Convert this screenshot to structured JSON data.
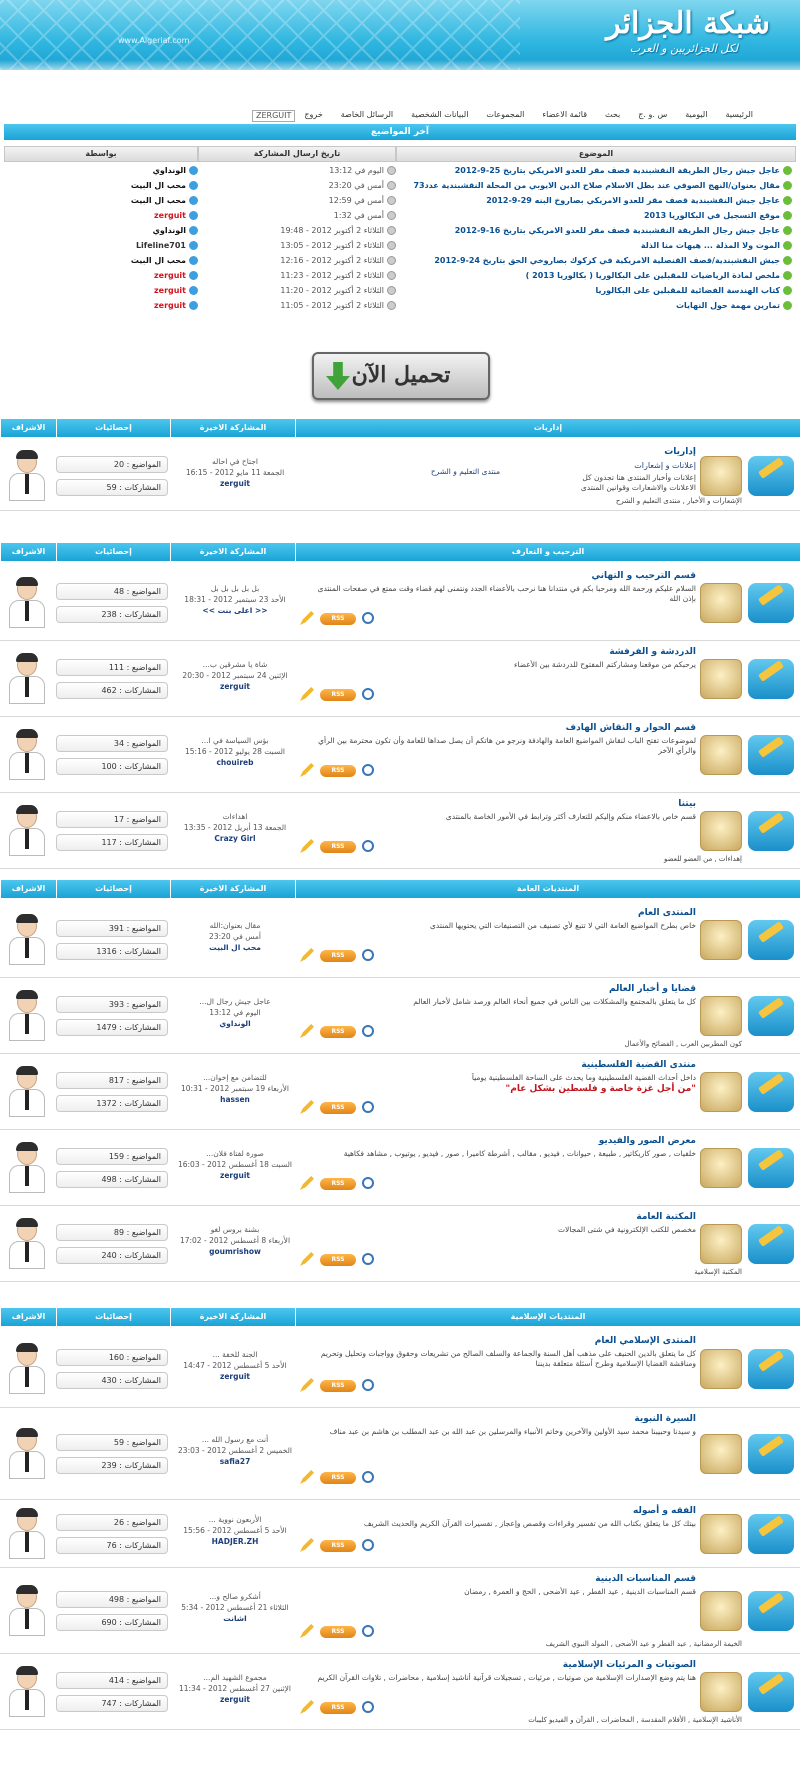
{
  "site": {
    "logo_title": "شبكة الجزائر",
    "logo_subtitle": "لكل الجزائريين و العرب",
    "logo_url": "www.Algeriaf.com"
  },
  "nav": {
    "items": [
      "الرئيسية",
      "اليومية",
      "س .و .ج",
      "بحث",
      "قائمة الاعضاء",
      "المجموعات",
      "البيانات الشخصية",
      "الرسائل الخاصة",
      "خروج"
    ],
    "user": "ZERGUIT"
  },
  "latest": {
    "title": "آخر المواضيع",
    "headers": {
      "topic": "الموضوع",
      "date": "تاريخ ارسال المشاركة",
      "by": "بواسطة"
    },
    "rows": [
      {
        "topic": "عاجل جيش رجال الطريقة النقشبندية قصف مقر للعدو الامريكي بتاريخ 25-9-2012",
        "date": "اليوم في 13:12",
        "user": "الونداوي",
        "color": "#111"
      },
      {
        "topic": "مقال بعنوان/النهج الصوفي عند بطل الاسلام صلاح الدين الايوبي من المحلة النقشبندية عدد73",
        "date": "أمس في 23:20",
        "user": "محب ال البيت",
        "color": "#111"
      },
      {
        "topic": "عاجل جيش النقشبندية قصف مقر للعدو الامريكي بصاروخ البنه 29-9-2012",
        "date": "أمس في 12:59",
        "user": "محب ال البيت",
        "color": "#111"
      },
      {
        "topic": "موقع التسجيل في البكالوريا 2013",
        "date": "أمس في 1:32",
        "user": "zerguit",
        "color": "#d0161f"
      },
      {
        "topic": "عاجل جيش رجال الطريقة النقشبندية قصف مقر للعدو الامريكي بتاريخ 16-9-2012",
        "date": "الثلاثاء 2 أكتوبر 2012 - 19:48",
        "user": "الونداوي",
        "color": "#111"
      },
      {
        "topic": "الموت ولا المذلة ... هيهات منا الذلة",
        "date": "الثلاثاء 2 أكتوبر 2012 - 13:05",
        "user": "Lifeline701",
        "color": "#333"
      },
      {
        "topic": "جيش النقشبندية/قصف القنصلية الامريكية في كركوك بصاروخي الحق بتاريخ 24-9-2012",
        "date": "الثلاثاء 2 أكتوبر 2012 - 12:16",
        "user": "محب ال البيت",
        "color": "#111"
      },
      {
        "topic": "ملخص لمادة الرياضيات للمقبلين على البكالوريا ( بكالوريا 2013 )",
        "date": "الثلاثاء 2 أكتوبر 2012 - 11:23",
        "user": "zerguit",
        "color": "#d0161f"
      },
      {
        "topic": "كتاب الهندسة الفضائية للمقبلين على البكالوريا",
        "date": "الثلاثاء 2 أكتوبر 2012 - 11:20",
        "user": "zerguit",
        "color": "#d0161f"
      },
      {
        "topic": "تمارين مهمة حول النهايات",
        "date": "الثلاثاء 2 أكتوبر 2012 - 11:05",
        "user": "zerguit",
        "color": "#d0161f"
      }
    ]
  },
  "download_label": "تحميل الآن",
  "col_headers": {
    "last": "المشاركة الاخيرة",
    "stats": "إحصائيات",
    "mod": "الاشراف"
  },
  "stat_labels": {
    "topics": "المواضيع :",
    "posts": "المشاركات :"
  },
  "sections": [
    {
      "title": "إداريات",
      "forums": [
        {
          "name": "إداريات",
          "desc": "إعلانات و إشعارات",
          "desc2": "إعلانات وأخبار المنتدى هنا تجدون كل الاعلانات والاشعارات وقوانين المنتدى",
          "sub": "الإشعارات و الأخبار , منتدى التعليم و الشرح",
          "last_title": "اجتاح في احاله",
          "last_date": "الجمعة 11 مايو 2012 - 16:15",
          "last_user": "zerguit",
          "topics": "20",
          "posts": "59",
          "extra": "منتدى التعليم و الشرح"
        }
      ]
    },
    {
      "title": "الترحيب و التعارف",
      "forums": [
        {
          "name": "قسم الترحيب و التهاني",
          "desc": "السلام عليكم ورحمة الله ومرحبا بكم في منتدانا هنا نرحب بالأعضاء الجدد ونتمنى لهم قضاء وقت ممتع في صفحات المنتدى بإذن الله",
          "sub": "",
          "last_title": "بل بل بل بل بل",
          "last_date": "الأحد 23 سبتمبر 2012 - 18:31",
          "last_user": "<< اعلى بنت >>",
          "topics": "48",
          "posts": "238"
        },
        {
          "name": "الدردشة و الفرفشة",
          "desc": "يرحبكم من موقعنا ومشاركتم المفتوح للدردشة بين الأعضاء",
          "sub": "",
          "last_title": "شاة يا مشرقين ب...",
          "last_date": "الإثنين 24 سبتمبر 2012 - 20:30",
          "last_user": "zerguit",
          "topics": "111",
          "posts": "462"
        },
        {
          "name": "قسم الحوار و النقاش الهادف",
          "desc": "لموضوعات تفتح الباب لنقاش المواضيع العامة والهادفة ونرجو من هاتكم أن يصل صداها للعامة وأن تكون محترمة بين الرأي والرأي الآخر",
          "sub": "",
          "last_title": "بؤس السياسة في ا...",
          "last_date": "السبت 28 يوليو 2012 - 15:16",
          "last_user": "chouireb",
          "topics": "34",
          "posts": "100"
        },
        {
          "name": "بيتنا",
          "desc": "قسم خاص بالاعضاء منكم وإليكم للتعارف أكثر وترابط في الأمور الخاصة بالمنتدى",
          "sub": "إهداءات , من العضو للعضو",
          "last_title": "اهداءات",
          "last_date": "الجمعة 13 أبريل 2012 - 13:35",
          "last_user": "Crazy Girl",
          "topics": "17",
          "posts": "117"
        }
      ]
    },
    {
      "title": "المنتديات العامة",
      "forums": [
        {
          "name": "المنتدى العام",
          "desc": "خاص بطرح المواضيع العامة التي لا تتبع لأي تصنيف من التصنيفات التي يحتويها المنتدى",
          "sub": "",
          "last_title": "مقال بعنوان:الله",
          "last_date": "أمس في 23:20",
          "last_user": "محب ال البيت",
          "topics": "391",
          "posts": "1316"
        },
        {
          "name": "قضايا و أخبار العالم",
          "desc": "كل ما يتعلق بالمجتمع والمشكلات بين الناس في جميع أنحاء العالم ورصد شامل لأخبار العالم",
          "sub": "كون المطربين العرب , الفضائح والأعمال",
          "last_title": "عاجل جيش رجال ال...",
          "last_date": "اليوم في 13:12",
          "last_user": "الونداوي",
          "topics": "393",
          "posts": "1479"
        },
        {
          "name": "منتدى القضية الفلسطينية",
          "desc": "داخل أحداث القضية الفلسطينية وما يحدث على الساحة الفلسطينية يومياً",
          "tagline": "\"من أجل غزة خاصة و فلسطين بشكل عام\"",
          "sub": "",
          "last_title": "للتضامن مع إخوان...",
          "last_date": "الأربعاء 19 سبتمبر 2012 - 10:31",
          "last_user": "hassen",
          "topics": "817",
          "posts": "1372"
        },
        {
          "name": "معرض الصور والفيديو",
          "desc": "خلفيات , صور كاريكاتير , طبيعة , حيوانات , فيديو , مقالب , أشرطة كاميرا , صور , فيديو , يوتيوب , مشاهد فكاهية",
          "sub": "",
          "last_title": "صورة لفتاة فلان...",
          "last_date": "السبت 18 أغسطس 2012 - 16:03",
          "last_user": "zerguit",
          "topics": "159",
          "posts": "498"
        },
        {
          "name": "المكتبة العامة",
          "desc": "مخصص للكتب الإلكترونية في شتى المجالات",
          "sub": "المكتبة الإسلامية",
          "last_title": "بشنة بروس لغو",
          "last_date": "الأربعاء 8 أغسطس 2012 - 17:02",
          "last_user": "goumrishow",
          "topics": "89",
          "posts": "240"
        }
      ]
    },
    {
      "title": "المنتديات الإسلامية",
      "forums": [
        {
          "name": "المنتدى الإسلامي العام",
          "desc": "كل ما يتعلق بالدين الحنيف على مذهب أهل السنة والجماعة والسلف الصالح من تشريعات وحقوق وواجبات وتحليل وتحريم ومناقشة القضايا الإسلامية وطرح أسئلة متعلقة بديننا",
          "sub": "",
          "last_title": "الجنة للخفة ...",
          "last_date": "الأحد 5 أغسطس 2012 - 14:47",
          "last_user": "zerguit",
          "topics": "160",
          "posts": "430"
        },
        {
          "name": "السيرة النبوية",
          "desc": "و سيدنا وحبيبنا محمد سيد الأولين والآخرين وخاتم الأنبياء والمرسلين بن عبد الله بن عبد المطلب بن هاشم بن عبد مناف",
          "sub": "",
          "last_title": "أنت مع رسول الله ...",
          "last_date": "الخميس 2 أغسطس 2012 - 23:03",
          "last_user": "safia27",
          "topics": "59",
          "posts": "239"
        },
        {
          "name": "الفقه و أصوله",
          "desc": "بيتك كل ما يتعلق بكتاب الله من تفسير وقراءات وقصص وإعجاز , تفسيرات القرآن الكريم والحديث الشريف",
          "sub": "",
          "last_title": "الأربعون نووية ...",
          "last_date": "الأحد 5 أغسطس 2012 - 15:56",
          "last_user": "HADJER.ZH",
          "topics": "26",
          "posts": "76"
        },
        {
          "name": "قسم المناسبات الدينية",
          "desc": "قسم المناسبات الدينية , عيد الفطر , عيد الأضحى , الحج و العمرة , رمضان",
          "sub": "الخيمة الرمضانية , عيد الفطر و عيد الأضحى , المولد النبوي الشريف",
          "last_title": "أشكرو صالح و...",
          "last_date": "الثلاثاء 21 أغسطس 2012 - 5:34",
          "last_user": "اشانت",
          "topics": "498",
          "posts": "690"
        },
        {
          "name": "الصوتيات و المرئيات الإسلامية",
          "desc": "هنا يتم وضع الإصدارات الإسلامية من صوتيات , مرئيات , تسجيلات قرآنية أناشيد إسلامية , محاضرات , تلاوات القرآن الكريم",
          "sub": "الأناشيد الإسلامية , الأفلام المقدسة , المحاضرات , القرآن و الفيديو كليبات",
          "last_title": "مجموع الشهيد الم...",
          "last_date": "الإثنين 27 أغسطس 2012 - 11:34",
          "last_user": "zerguit",
          "topics": "414",
          "posts": "747"
        }
      ]
    }
  ],
  "colors": {
    "accent": "#1aa3d6",
    "title": "#0a4f8f",
    "admin": "#d0161f"
  }
}
